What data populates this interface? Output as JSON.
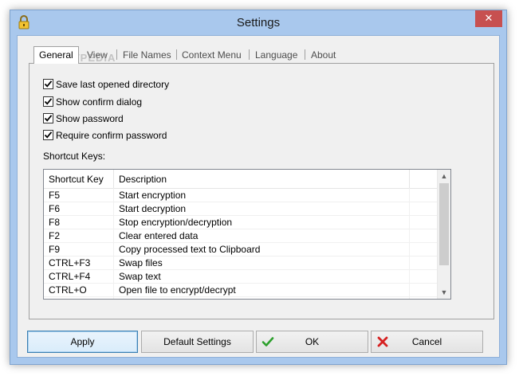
{
  "window": {
    "title": "Settings",
    "close_glyph": "✕"
  },
  "tabs": [
    {
      "label": "General",
      "active": true
    },
    {
      "label": "View"
    },
    {
      "label": "File Names"
    },
    {
      "label": "Context Menu"
    },
    {
      "label": "Language"
    },
    {
      "label": "About"
    }
  ],
  "options": [
    {
      "label": "Save last opened directory",
      "checked": true
    },
    {
      "label": "Show confirm dialog",
      "checked": true
    },
    {
      "label": "Show password",
      "checked": true
    },
    {
      "label": "Require confirm password",
      "checked": true
    }
  ],
  "shortcuts": {
    "label": "Shortcut Keys:",
    "columns": [
      "Shortcut Key",
      "Description"
    ],
    "rows": [
      [
        "F5",
        "Start encryption"
      ],
      [
        "F6",
        "Start decryption"
      ],
      [
        "F8",
        "Stop encryption/decryption"
      ],
      [
        "F2",
        "Clear entered data"
      ],
      [
        "F9",
        "Copy processed text to Clipboard"
      ],
      [
        "CTRL+F3",
        "Swap files"
      ],
      [
        "CTRL+F4",
        "Swap text"
      ],
      [
        "CTRL+O",
        "Open file to encrypt/decrypt"
      ]
    ]
  },
  "buttons": {
    "apply": "Apply",
    "default_settings": "Default Settings",
    "ok": "OK",
    "cancel": "Cancel"
  },
  "watermark": "SOFTPEDIA",
  "colors": {
    "accent": "#3c7fb1",
    "close": "#c75050",
    "ok_icon": "#2ca02c",
    "cancel_icon": "#d62020"
  }
}
